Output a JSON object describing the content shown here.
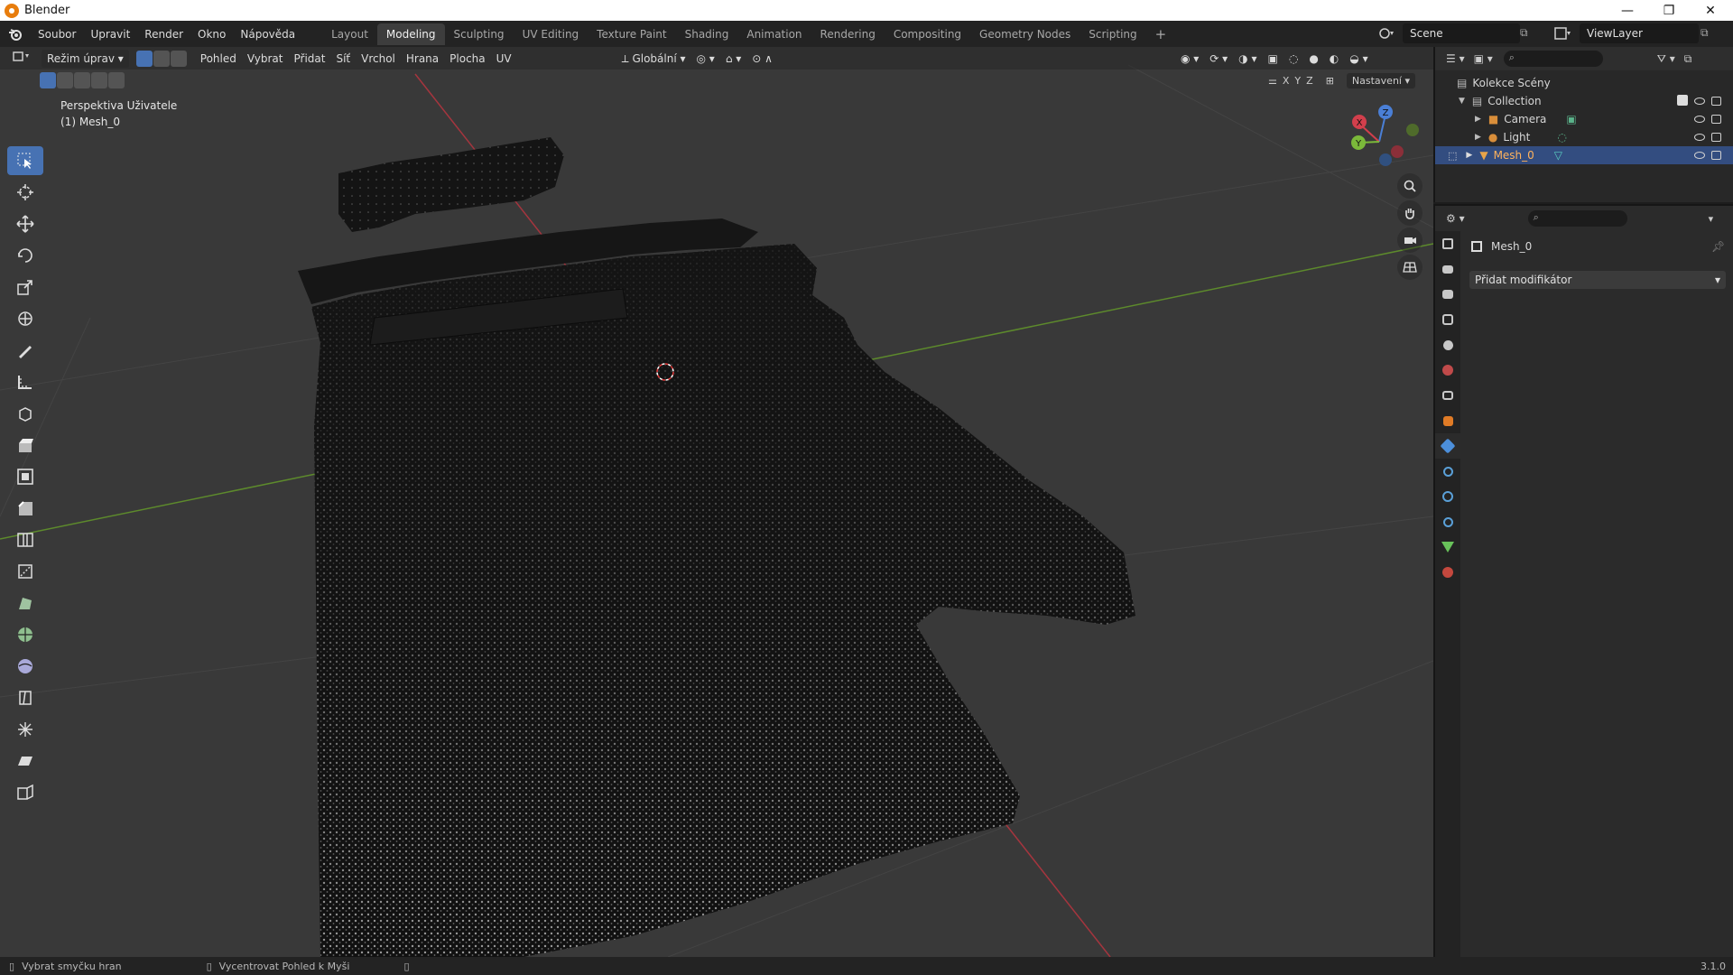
{
  "window": {
    "title": "Blender",
    "controls": [
      "—",
      "❐",
      "✕"
    ]
  },
  "menu": [
    "Soubor",
    "Upravit",
    "Render",
    "Okno",
    "Nápověda"
  ],
  "workspaces": [
    {
      "label": "Layout",
      "active": false
    },
    {
      "label": "Modeling",
      "active": true
    },
    {
      "label": "Sculpting",
      "active": false
    },
    {
      "label": "UV Editing",
      "active": false
    },
    {
      "label": "Texture Paint",
      "active": false
    },
    {
      "label": "Shading",
      "active": false
    },
    {
      "label": "Animation",
      "active": false
    },
    {
      "label": "Rendering",
      "active": false
    },
    {
      "label": "Compositing",
      "active": false
    },
    {
      "label": "Geometry Nodes",
      "active": false
    },
    {
      "label": "Scripting",
      "active": false
    }
  ],
  "add_workspace": "+",
  "scene": {
    "name": "Scene",
    "view_layer": "ViewLayer"
  },
  "viewport_header": {
    "mode": "Režim úprav",
    "menus": [
      "Pohled",
      "Vybrat",
      "Přidat",
      "Síť",
      "Vrchol",
      "Hrana",
      "Plocha",
      "UV"
    ],
    "orientation": "Globální",
    "axes": [
      "X",
      "Y",
      "Z"
    ],
    "options": "Nastavení"
  },
  "viewport": {
    "view_name": "Perspektiva Uživatele",
    "object_name": "(1) Mesh_0",
    "gizmo_axes": [
      "X",
      "Y",
      "Z"
    ]
  },
  "tools": [
    {
      "name": "select-box-tool",
      "active": true
    },
    {
      "name": "cursor-tool",
      "active": false
    },
    {
      "name": "move-tool",
      "active": false
    },
    {
      "name": "rotate-tool",
      "active": false
    },
    {
      "name": "scale-tool",
      "active": false
    },
    {
      "name": "transform-tool",
      "active": false
    },
    {
      "name": "annotate-tool",
      "active": false
    },
    {
      "name": "measure-tool",
      "active": false
    },
    {
      "name": "add-cube-tool",
      "active": false
    },
    {
      "name": "extrude-tool",
      "active": false
    },
    {
      "name": "inset-tool",
      "active": false
    },
    {
      "name": "bevel-tool",
      "active": false
    },
    {
      "name": "loop-cut-tool",
      "active": false
    },
    {
      "name": "knife-tool",
      "active": false
    },
    {
      "name": "poly-build-tool",
      "active": false
    },
    {
      "name": "spin-tool",
      "active": false
    },
    {
      "name": "smooth-tool",
      "active": false
    },
    {
      "name": "edge-slide-tool",
      "active": false
    },
    {
      "name": "shrink-fatten-tool",
      "active": false
    },
    {
      "name": "shear-tool",
      "active": false
    },
    {
      "name": "rip-region-tool",
      "active": false
    }
  ],
  "outliner": {
    "root": "Kolekce Scény",
    "collection": "Collection",
    "items": [
      {
        "label": "Camera",
        "color": "#d98e3a",
        "selected": false
      },
      {
        "label": "Light",
        "color": "#d98e3a",
        "selected": false
      },
      {
        "label": "Mesh_0",
        "color": "#e8a44a",
        "selected": true
      }
    ]
  },
  "properties": {
    "object_name": "Mesh_0",
    "add_modifier": "Přidat modifikátor",
    "tab_colors": [
      "#c8c8c8",
      "#c8c8c8",
      "#c8c8c8",
      "#c8c8c8",
      "#c8c8c8",
      "#c04a4a",
      "#c8c8c8",
      "#e07b26",
      "#4c8fdb",
      "#5aa0d8",
      "#5aa0d8",
      "#5aa0d8",
      "#68c25a",
      "#c4483e"
    ]
  },
  "statusbar": {
    "hint1": "Vybrat smyčku hran",
    "hint2": "Vycentrovat Pohled k Myši",
    "version": "3.1.0"
  }
}
